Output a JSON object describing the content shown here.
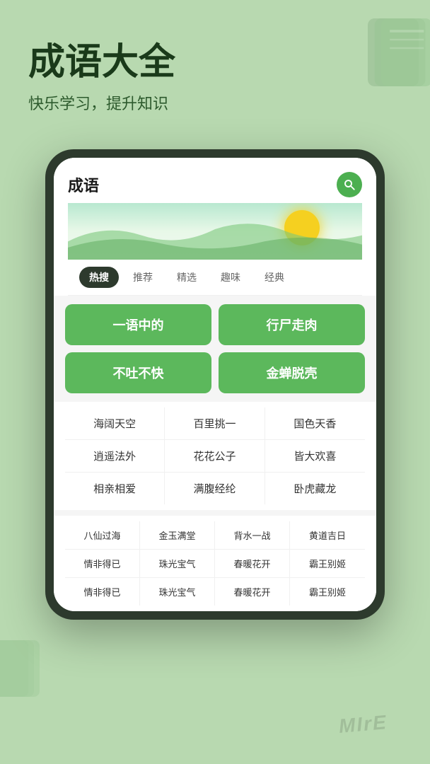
{
  "header": {
    "title": "成语大全",
    "subtitle": "快乐学习，提升知识"
  },
  "app": {
    "title": "成语",
    "search_icon": "search"
  },
  "tabs": [
    {
      "label": "热搜",
      "active": true
    },
    {
      "label": "推荐",
      "active": false
    },
    {
      "label": "精选",
      "active": false
    },
    {
      "label": "趣味",
      "active": false
    },
    {
      "label": "经典",
      "active": false
    }
  ],
  "hot_items": [
    {
      "text": "一语中的"
    },
    {
      "text": "行尸走肉"
    },
    {
      "text": "不吐不快"
    },
    {
      "text": "金蝉脱壳"
    }
  ],
  "normal_rows": [
    [
      "海阔天空",
      "百里挑一",
      "国色天香"
    ],
    [
      "逍遥法外",
      "花花公子",
      "皆大欢喜"
    ],
    [
      "相亲相爱",
      "满腹经纶",
      "卧虎藏龙"
    ]
  ],
  "four_col_rows": [
    [
      "八仙过海",
      "金玉满堂",
      "背水一战",
      "黄道吉日"
    ],
    [
      "情非得已",
      "珠光宝气",
      "春暖花开",
      "霸王别姬"
    ],
    [
      "情非得已",
      "珠光宝气",
      "春暖花开",
      "霸王别姬"
    ]
  ],
  "watermark": "MIrE"
}
